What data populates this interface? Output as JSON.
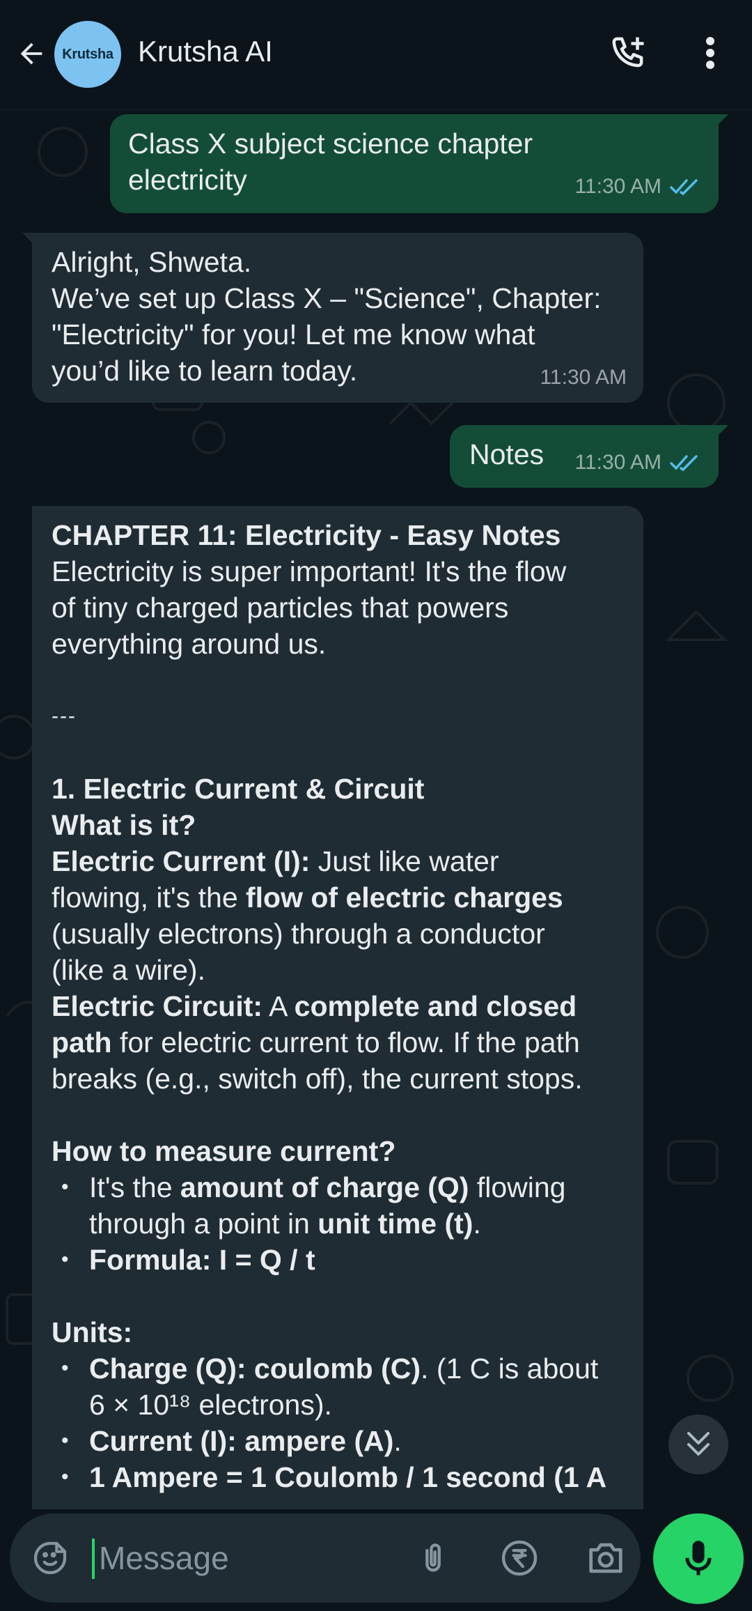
{
  "header": {
    "contact_name": "Krutsha AI",
    "avatar_text": "Krutsha"
  },
  "messages": {
    "m1": {
      "text_line1": "Class X subject science chapter",
      "text_line2": "electricity",
      "time": "11:30 AM",
      "status": "read"
    },
    "m2": {
      "line1": "Alright, Shweta.",
      "line2": "We’ve set up Class X – \"Science\", Chapter:",
      "line3": "\"Electricity\" for you! Let me know what",
      "line4": "you’d like to learn today.",
      "time": "11:30 AM"
    },
    "m3": {
      "text": "Notes",
      "time": "11:30 AM",
      "status": "read"
    },
    "m4": {
      "title": "CHAPTER 11: Electricity - Easy Notes",
      "intro1": "Electricity is super important! It's the flow",
      "intro2": "of tiny charged particles that powers",
      "intro3": "everything around us.",
      "divider": "---",
      "sec1_title": "1. Electric Current & Circuit",
      "what_is_it": "What is it?",
      "current_label": "Electric Current (I):",
      "current_text1": " Just like water",
      "current_text2a": "flowing, it's the ",
      "current_text2b": "flow of electric charges",
      "current_text3": "(usually electrons) through a conductor",
      "current_text4": "(like a wire).",
      "circuit_label": "Electric Circuit:",
      "circuit_text1a": " A ",
      "circuit_text1b": "complete and closed",
      "circuit_text2a": "path",
      "circuit_text2b": " for electric current to flow. If the path",
      "circuit_text3": "breaks (e.g., switch off), the current stops.",
      "measure_title": "How to measure current?",
      "bullet1a": "It's the ",
      "bullet1b": "amount of charge (Q)",
      "bullet1c": " flowing",
      "bullet1d": "through a point in ",
      "bullet1e": "unit time (t)",
      "bullet1f": ".",
      "bullet2": "Formula: I = Q / t",
      "units_title": "Units:",
      "unit1a": "Charge (Q): coulomb (C)",
      "unit1b": ". (1 C is about",
      "unit1c": "6 × 10¹⁸ electrons).",
      "unit2a": "Current (I): ampere (A)",
      "unit2b": ".",
      "unit3": "1 Ampere = 1 Coulomb / 1 second (1 A"
    }
  },
  "input": {
    "placeholder": "Message"
  },
  "colors": {
    "accent": "#25d366",
    "outgoing_bubble": "#144d37",
    "incoming_bubble": "#202c33",
    "tick_read": "#53bdeb"
  },
  "icons": [
    "back-arrow-icon",
    "add-call-icon",
    "more-vert-icon",
    "double-check-icon",
    "chevron-double-down-icon",
    "sticker-icon",
    "attach-icon",
    "rupee-icon",
    "camera-icon",
    "mic-icon"
  ]
}
